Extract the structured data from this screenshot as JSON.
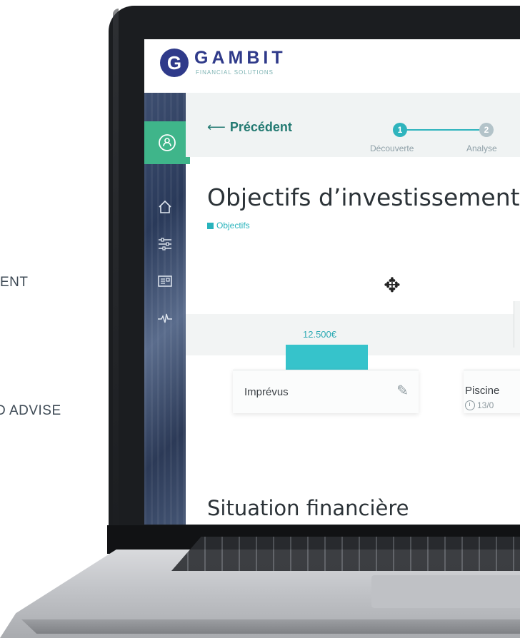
{
  "side_texts": {
    "line1": "ENT",
    "line2": "D ADVISE"
  },
  "brand": {
    "logo_letter": "G",
    "name": "GAMBIT",
    "subtitle": "FINANCIAL SOLUTIONS",
    "primary_color": "#2f3a8a",
    "accent_color": "#28b3bc",
    "green": "#3fb58a"
  },
  "sidebar": {
    "items": [
      {
        "name": "profile",
        "icon": "user-circle-icon"
      },
      {
        "name": "home",
        "icon": "home-icon"
      },
      {
        "name": "settings",
        "icon": "sliders-icon"
      },
      {
        "name": "documents",
        "icon": "card-icon"
      },
      {
        "name": "activity",
        "icon": "pulse-icon"
      }
    ]
  },
  "stepper": {
    "back_label": "Précédent",
    "steps": [
      {
        "number": "1",
        "label": "Découverte",
        "state": "active"
      },
      {
        "number": "2",
        "label": "Analyse",
        "state": "pending"
      }
    ]
  },
  "page": {
    "title": "Objectifs d’investissement",
    "tag": "Objectifs"
  },
  "objectives": [
    {
      "label": "Imprévus",
      "amount": "12.500€"
    },
    {
      "label": "Piscine",
      "date": "13/0"
    }
  ],
  "section2": {
    "title": "Situation financière"
  }
}
